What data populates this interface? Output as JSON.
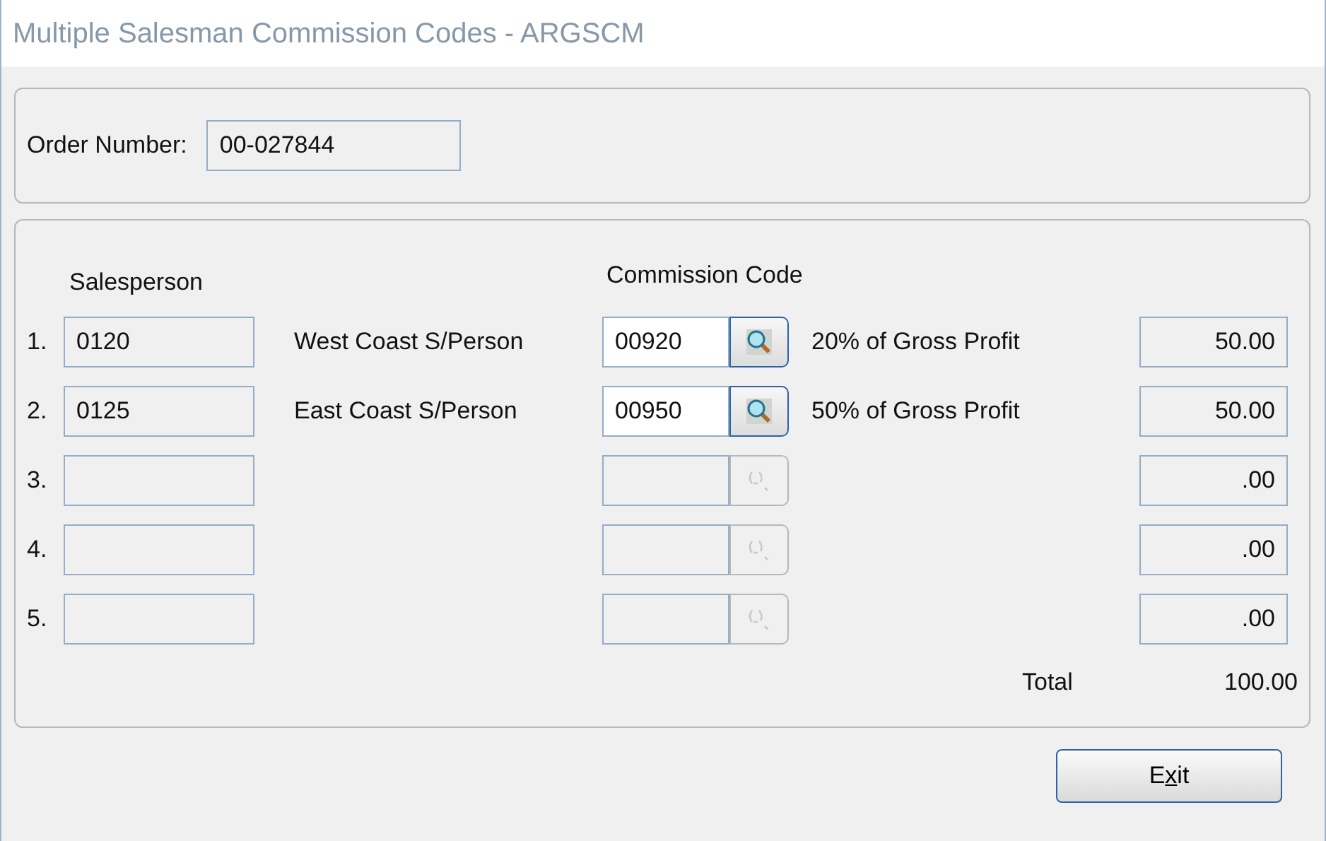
{
  "window": {
    "title": "Multiple Salesman Commission Codes - ARGSCM"
  },
  "order": {
    "label": "Order Number:",
    "value": "00-027844"
  },
  "columns": {
    "salesperson": "Salesperson",
    "commission_code": "Commission Code"
  },
  "rows": [
    {
      "number": "1.",
      "salesperson": "0120",
      "salesperson_name": "West Coast S/Person",
      "code": "00920",
      "lookup_disabled": false,
      "code_description": "20% of Gross Profit",
      "amount": "50.00"
    },
    {
      "number": "2.",
      "salesperson": "0125",
      "salesperson_name": "East Coast S/Person",
      "code": "00950",
      "lookup_disabled": false,
      "code_description": "50% of Gross Profit",
      "amount": "50.00"
    },
    {
      "number": "3.",
      "lookup_disabled": true,
      "amount": ".00"
    },
    {
      "number": "4.",
      "lookup_disabled": true,
      "amount": ".00"
    },
    {
      "number": "5.",
      "lookup_disabled": true,
      "amount": ".00"
    }
  ],
  "total": {
    "label": "Total",
    "value": "100.00"
  },
  "exit_button": {
    "label_parts": [
      {
        "text": "E",
        "underlined": false
      },
      {
        "text": "x",
        "underlined": true
      },
      {
        "text": "it",
        "underlined": false
      }
    ]
  }
}
